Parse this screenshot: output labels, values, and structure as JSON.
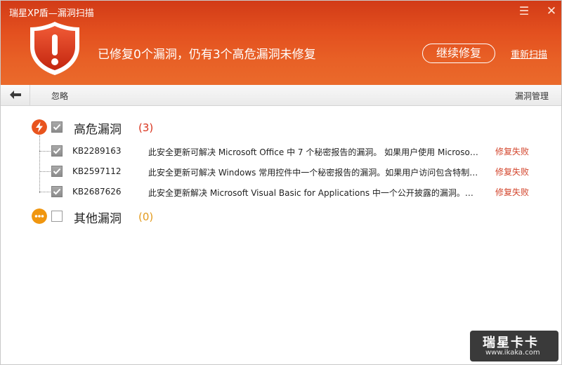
{
  "window": {
    "title": "瑞星XP盾—漏洞扫描"
  },
  "header": {
    "summary": "已修复0个漏洞，仍有3个高危漏洞未修复",
    "continue_button": "继续修复",
    "rescan_link": "重新扫描"
  },
  "toolbar": {
    "ignore": "忽略",
    "manage": "漏洞管理"
  },
  "groups": [
    {
      "label": "高危漏洞",
      "count": "(3)",
      "checked": true,
      "icon": "lightning-icon",
      "color": "#e8541e",
      "items": [
        {
          "kb": "KB2289163",
          "desc": "此安全更新可解决 Microsoft Office 中 7 个秘密报告的漏洞。 如果用户使用 Microsoft Office",
          "status": "修复失败",
          "checked": true
        },
        {
          "kb": "KB2597112",
          "desc": "此安全更新可解决 Windows 常用控件中一个秘密报告的漏洞。如果用户访问包含特制内容的网站",
          "status": "修复失败",
          "checked": true
        },
        {
          "kb": "KB2687626",
          "desc": "此安全更新解决 Microsoft Visual Basic for Applications 中一个公开披露的漏洞。如果用户打开",
          "status": "修复失败",
          "checked": true
        }
      ]
    },
    {
      "label": "其他漏洞",
      "count": "(0)",
      "checked": false,
      "icon": "more-icon",
      "color": "#f0960f"
    }
  ],
  "watermark": {
    "brand": "瑞星卡卡",
    "url": "www.ikaka.com"
  },
  "colors": {
    "header_top": "#d23b17",
    "header_bottom": "#ea6a2b",
    "fail_status": "#d3452c",
    "high_risk_count": "#d9341e",
    "other_count": "#e39a1c"
  }
}
